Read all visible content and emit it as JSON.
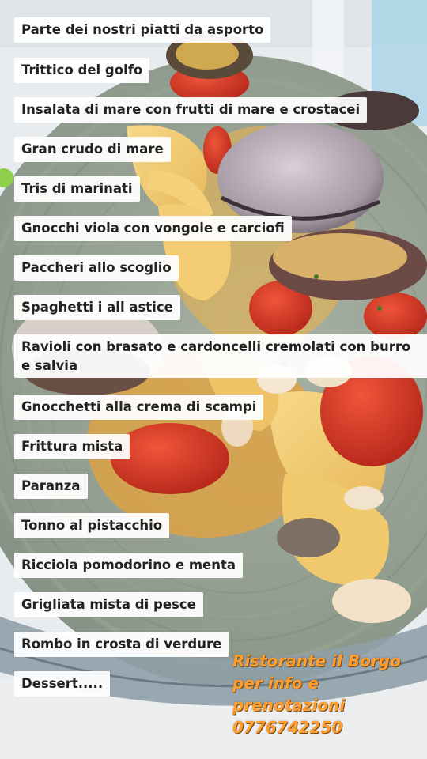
{
  "menu": {
    "items": [
      "Parte dei nostri piatti da asporto",
      "Trittico del golfo",
      "Insalata di mare con frutti di mare e crostacei",
      "Gran crudo di mare",
      "Tris di marinati",
      "Gnocchi viola con vongole e carciofi",
      "Paccheri allo scoglio",
      "Spaghetti i all astice",
      "Ravioli con brasato e cardoncelli cremolati con burro e salvia",
      "Gnocchetti alla crema di scampi",
      "Frittura mista",
      "Paranza",
      "Tonno al pistacchio",
      "Ricciola pomodorino e menta",
      "Grigliata mista di pesce",
      "Rombo in crosta di verdure",
      "Dessert....."
    ]
  },
  "promo": {
    "line1": "Ristorante il Borgo",
    "line2": "per info e",
    "line3": "prenotazioni",
    "phone": "0776742250",
    "color": "#ff9d2e"
  }
}
